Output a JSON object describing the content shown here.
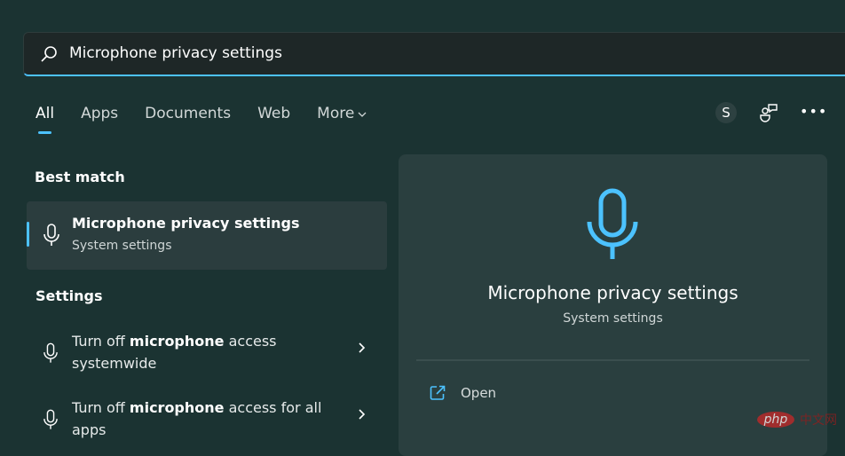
{
  "search": {
    "value": "Microphone privacy settings",
    "icon": "search-icon"
  },
  "tabs": [
    {
      "label": "All",
      "active": true
    },
    {
      "label": "Apps"
    },
    {
      "label": "Documents"
    },
    {
      "label": "Web"
    },
    {
      "label": "More"
    }
  ],
  "header": {
    "avatar_initial": "S",
    "more_options": "•••"
  },
  "best_match": {
    "heading": "Best match",
    "title": "Microphone privacy settings",
    "subtitle": "System settings"
  },
  "settings": {
    "heading": "Settings",
    "items": [
      {
        "pre": "Turn off ",
        "bold": "microphone",
        "post": " access",
        "line2": "systemwide"
      },
      {
        "pre": "Turn off ",
        "bold": "microphone",
        "post": " access for all",
        "line2": "apps"
      }
    ]
  },
  "preview": {
    "title": "Microphone privacy settings",
    "subtitle": "System settings",
    "open_label": "Open"
  },
  "watermark": {
    "logo": "php",
    "text": "中文网"
  },
  "colors": {
    "accent": "#4cc2ff",
    "background": "#1b3332",
    "panel": "#2a3f3f"
  }
}
